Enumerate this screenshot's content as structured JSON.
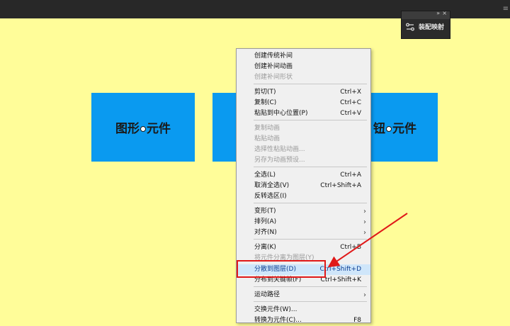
{
  "stage_symbols": {
    "graphic": "图形",
    "graphic_suffix": "元件",
    "button": "钮",
    "button_suffix": "元件"
  },
  "panel": {
    "dbl_arrow": "»",
    "close": "×",
    "label": "装配映射"
  },
  "menu": [
    {
      "label": "创建传统补间",
      "shortcut": "",
      "disabled": false
    },
    {
      "label": "创建补间动画",
      "shortcut": "",
      "disabled": false
    },
    {
      "label": "创建补间形状",
      "shortcut": "",
      "disabled": true
    },
    {
      "label": "剪切(T)",
      "shortcut": "Ctrl+X",
      "disabled": false
    },
    {
      "label": "复制(C)",
      "shortcut": "Ctrl+C",
      "disabled": false
    },
    {
      "label": "粘贴到中心位置(P)",
      "shortcut": "Ctrl+V",
      "disabled": false
    },
    {
      "label": "复制动画",
      "shortcut": "",
      "disabled": true
    },
    {
      "label": "粘贴动画",
      "shortcut": "",
      "disabled": true
    },
    {
      "label": "选择性粘贴动画...",
      "shortcut": "",
      "disabled": true
    },
    {
      "label": "另存为动画预设...",
      "shortcut": "",
      "disabled": true
    },
    {
      "label": "全选(L)",
      "shortcut": "Ctrl+A",
      "disabled": false
    },
    {
      "label": "取消全选(V)",
      "shortcut": "Ctrl+Shift+A",
      "disabled": false
    },
    {
      "label": "反转选区(I)",
      "shortcut": "",
      "disabled": false
    },
    {
      "label": "变形(T)",
      "shortcut": "",
      "submenu": true
    },
    {
      "label": "排列(A)",
      "shortcut": "",
      "submenu": true
    },
    {
      "label": "对齐(N)",
      "shortcut": "",
      "submenu": true
    },
    {
      "label": "分离(K)",
      "shortcut": "Ctrl+B",
      "disabled": false
    },
    {
      "label": "将元件分离为图层(Y)",
      "shortcut": "",
      "disabled": true
    },
    {
      "label": "分散到图层(D)",
      "shortcut": "Ctrl+Shift+D",
      "hover": true
    },
    {
      "label": "分布到关键帧(F)",
      "shortcut": "Ctrl+Shift+K",
      "disabled": false
    },
    {
      "label": "运动路径",
      "shortcut": "",
      "submenu": true
    },
    {
      "label": "交换元件(W)...",
      "shortcut": "",
      "disabled": false
    },
    {
      "label": "转换为元件(C)...",
      "shortcut": "F8",
      "disabled": false
    }
  ],
  "submenu_arrow": "›",
  "colors": {
    "stage": "#fffd99",
    "symbol": "#0a9af0",
    "annotation": "#e01919",
    "hover": "#cfe6fa"
  }
}
